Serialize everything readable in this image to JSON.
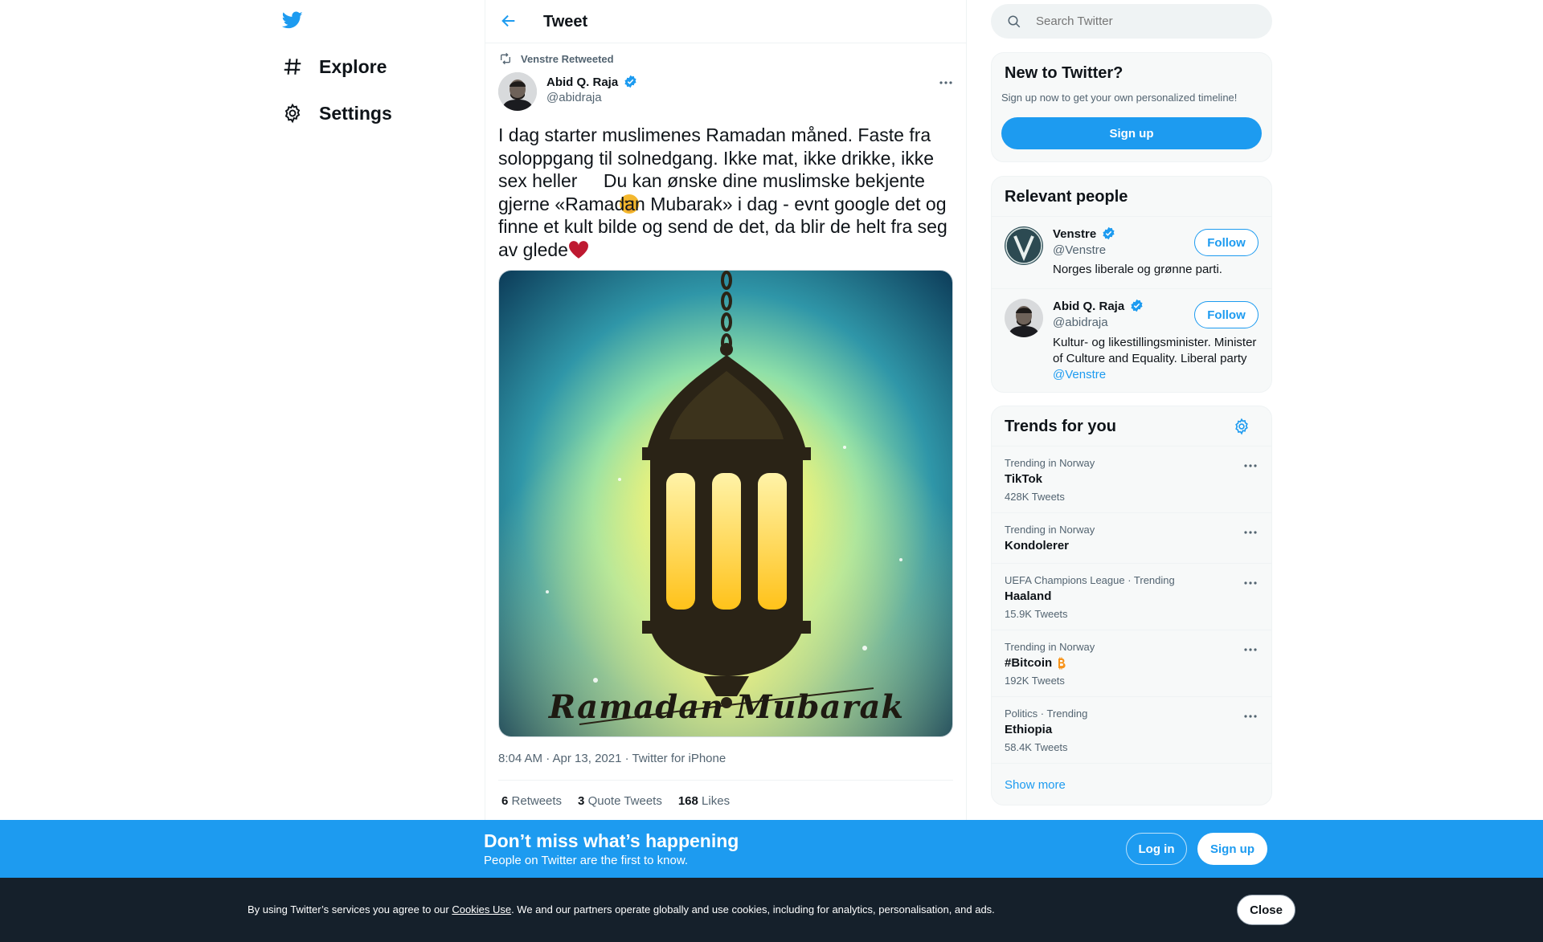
{
  "nav": {
    "explore_label": "Explore",
    "settings_label": "Settings"
  },
  "header": {
    "title": "Tweet"
  },
  "tweet": {
    "social_context": "Venstre Retweeted",
    "author_name": "Abid Q. Raja",
    "author_handle": "@abidraja",
    "text_lines": [
      "I dag starter muslimenes Ramadan måned. Faste fra",
      "soloppgang til solnedgang. Ikke mat, ikke drikke, ikke",
      "sex heller",
      " Du kan ønske dine muslimske bekjente",
      "gjerne «Ramadan Mubarak» i dag - evnt google det og",
      "finne et kult bilde og send de det, da blir de helt fra seg",
      "av glede"
    ],
    "image_caption": "Ramadan Mubarak",
    "timestamp": "8:04 AM · Apr 13, 2021 · Twitter for iPhone",
    "stats": {
      "retweets_count": "6",
      "retweets_label": "Retweets",
      "quotes_count": "3",
      "quotes_label": "Quote Tweets",
      "likes_count": "168",
      "likes_label": "Likes"
    }
  },
  "search": {
    "placeholder": "Search Twitter"
  },
  "new_to_twitter": {
    "title": "New to Twitter?",
    "subtitle": "Sign up now to get your own personalized timeline!",
    "signup_label": "Sign up"
  },
  "relevant_people": {
    "title": "Relevant people",
    "people": [
      {
        "name": "Venstre",
        "handle": "@Venstre",
        "bio": "Norges liberale og grønne parti.",
        "follow_label": "Follow"
      },
      {
        "name": "Abid Q. Raja",
        "handle": "@abidraja",
        "bio_line1": "Kultur- og likestillingsminister. Minister",
        "bio_line2": "of Culture and Equality. Liberal party",
        "bio_mention": "@Venstre",
        "follow_label": "Follow"
      }
    ]
  },
  "trends": {
    "title": "Trends for you",
    "items": [
      {
        "meta": "Trending in Norway",
        "name": "TikTok",
        "count": "428K Tweets"
      },
      {
        "meta": "Trending in Norway",
        "name": "Kondolerer",
        "count": ""
      },
      {
        "meta": "UEFA Champions League · Trending",
        "name": "Haaland",
        "count": "15.9K Tweets"
      },
      {
        "meta": "Trending in Norway",
        "name": "#Bitcoin",
        "count": "192K Tweets"
      },
      {
        "meta": "Politics · Trending",
        "name": "Ethiopia",
        "count": "58.4K Tweets"
      }
    ],
    "show_more": "Show more"
  },
  "banner": {
    "title": "Don’t miss what’s happening",
    "subtitle": "People on Twitter are the first to know.",
    "login_label": "Log in",
    "signup_label": "Sign up"
  },
  "cookie": {
    "text_before": "By using Twitter’s services you agree to our ",
    "link": "Cookies Use",
    "text_after": ". We and our partners operate globally and use cookies, including for analytics, personalisation, and ads.",
    "close_label": "Close"
  },
  "colors": {
    "accent": "#1d9bf0",
    "text": "#0f1419",
    "secondary": "#536471",
    "dark": "#15202b"
  }
}
